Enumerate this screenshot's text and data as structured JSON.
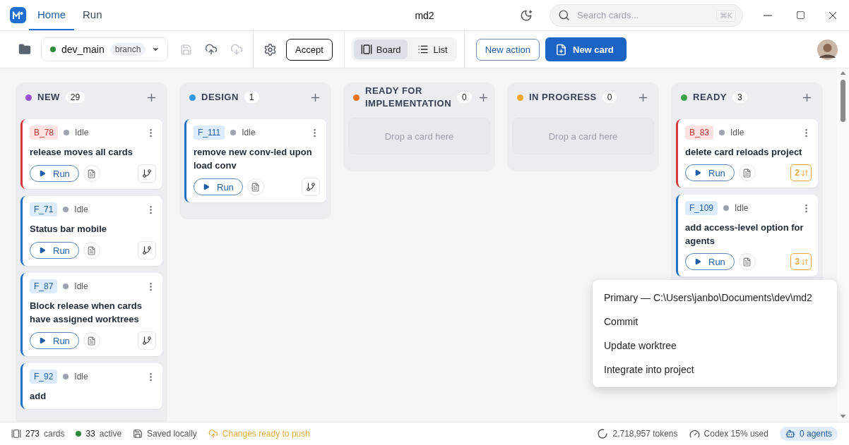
{
  "titlebar": {
    "title": "md2",
    "tabs": [
      {
        "label": "Home",
        "selected": true
      },
      {
        "label": "Run",
        "selected": false
      }
    ],
    "search": {
      "placeholder": "Search cards...",
      "shortcut": "⌘K"
    }
  },
  "toolbar": {
    "branch": {
      "name": "dev_main",
      "badge": "branch"
    },
    "save": {
      "disabled": true
    },
    "push": {
      "disabled": false
    },
    "pull": {
      "disabled": true
    },
    "accept": "Accept",
    "views": [
      {
        "label": "Board",
        "selected": true
      },
      {
        "label": "List",
        "selected": false
      }
    ],
    "new_action": "New action",
    "new_card": "New card"
  },
  "columns": [
    {
      "title": "NEW",
      "count": "29",
      "color": "#9b4fd1",
      "cards": [
        {
          "kind": "bug",
          "id": "B_78",
          "status": "Idle",
          "title": "release moves all cards",
          "run": "Run",
          "footer": {
            "kind": "branch"
          }
        },
        {
          "kind": "feature",
          "id": "F_71",
          "status": "Idle",
          "title": "Status bar mobile",
          "run": "Run",
          "footer": {
            "kind": "branch"
          }
        },
        {
          "kind": "feature",
          "id": "F_87",
          "status": "Idle",
          "title": "Block release when cards have assigned worktrees",
          "run": "Run",
          "footer": {
            "kind": "branch"
          }
        },
        {
          "kind": "feature",
          "id": "F_92",
          "status": "Idle",
          "title": "add"
        }
      ]
    },
    {
      "title": "DESIGN",
      "count": "1",
      "color": "#2f9be0",
      "cards": [
        {
          "kind": "feature",
          "id": "F_111",
          "status": "Idle",
          "title": "remove new conv-led upon load conv",
          "run": "Run",
          "footer": {
            "kind": "branch"
          }
        }
      ]
    },
    {
      "title": "READY FOR IMPLEMENTATION",
      "count": "0",
      "color": "#e8731c",
      "empty": "Drop a card here"
    },
    {
      "title": "IN PROGRESS",
      "count": "0",
      "color": "#f0a72c",
      "empty": "Drop a card here"
    },
    {
      "title": "READY",
      "count": "3",
      "color": "#3aa24a",
      "cards": [
        {
          "kind": "bug",
          "id": "B_83",
          "status": "Idle",
          "title": "delete card reloads project",
          "run": "Run",
          "footer": {
            "kind": "changes",
            "count": "2"
          }
        },
        {
          "kind": "feature",
          "id": "F_109",
          "status": "Idle",
          "title": "add access-level option for agents",
          "run": "Run",
          "footer": {
            "kind": "changes",
            "count": "3"
          }
        }
      ]
    }
  ],
  "context_menu": [
    "Primary — C:\\Users\\janbo\\Documents\\dev\\md2",
    "Commit",
    "Update worktree",
    "Integrate into project"
  ],
  "status_bar": {
    "cards": {
      "value": "273",
      "label": "cards"
    },
    "active": {
      "value": "33",
      "label": "active"
    },
    "saved": "Saved locally",
    "changes": "Changes ready to push",
    "tokens": "2,718,957 tokens",
    "usage": "Codex 15% used",
    "agents": "0 agents"
  }
}
